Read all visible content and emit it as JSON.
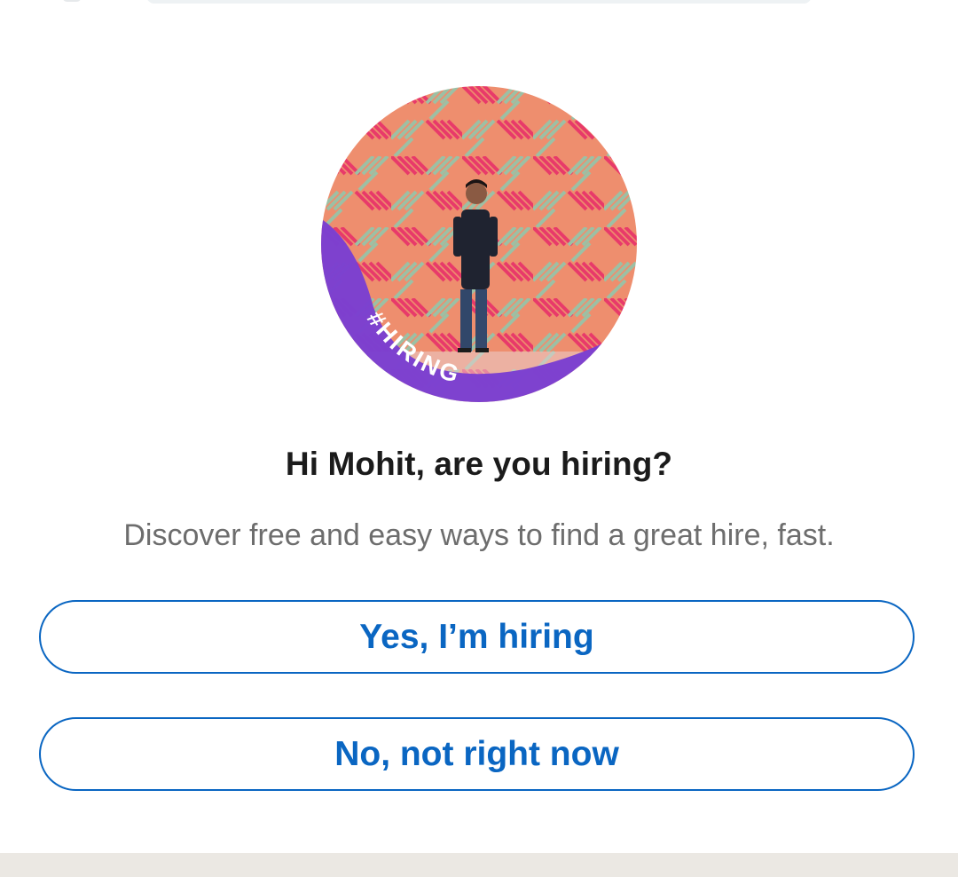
{
  "dialog": {
    "frame_badge": "#HIRING",
    "headline": "Hi Mohit, are you hiring?",
    "subtext": "Discover free and easy ways to find a great hire, fast.",
    "primary_button": "Yes, I’m hiring",
    "secondary_button": "No, not right now"
  },
  "colors": {
    "accent": "#0a66c2",
    "hiring_frame": "#7b3fd0",
    "headline": "#1b1b1b",
    "subtext": "#6d6d6d"
  }
}
